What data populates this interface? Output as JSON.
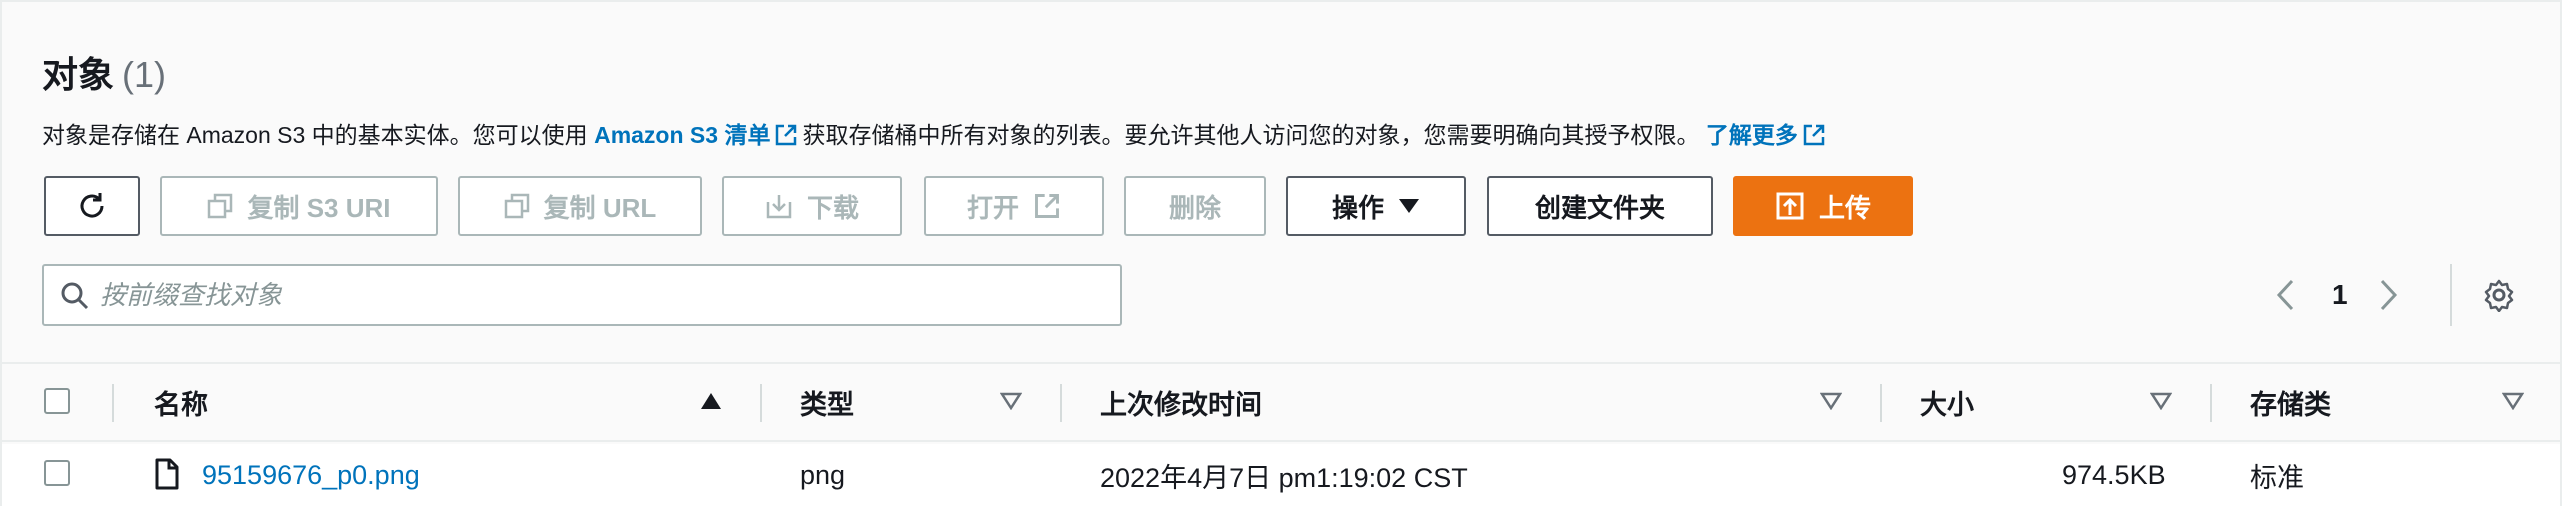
{
  "header": {
    "title": "对象",
    "count": "(1)",
    "desc_before": "对象是存储在 Amazon S3 中的基本实体。您可以使用",
    "desc_link": "Amazon S3 清单",
    "desc_middle": "获取存储桶中所有对象的列表。要允许其他人访问您的对象，您需要明确向其授予权限。",
    "learn_more": "了解更多"
  },
  "toolbar": {
    "refresh_icon": "refresh-icon",
    "copy_s3_uri": "复制 S3 URI",
    "copy_url": "复制 URL",
    "download": "下载",
    "open": "打开",
    "delete": "删除",
    "actions": "操作",
    "create_folder": "创建文件夹",
    "upload": "上传"
  },
  "search": {
    "placeholder": "按前缀查找对象"
  },
  "pagination": {
    "page": "1"
  },
  "table": {
    "columns": [
      "名称",
      "类型",
      "上次修改时间",
      "大小",
      "存储类"
    ],
    "rows": [
      {
        "name": "95159676_p0.png",
        "type": "png",
        "modified": "2022年4月7日 pm1:19:02 CST",
        "size": "974.5KB",
        "storage_class": "标准"
      }
    ]
  },
  "colors": {
    "link": "#0073bb",
    "primary": "#ec7211",
    "disabled": "#aab7b8",
    "text": "#16191f"
  }
}
